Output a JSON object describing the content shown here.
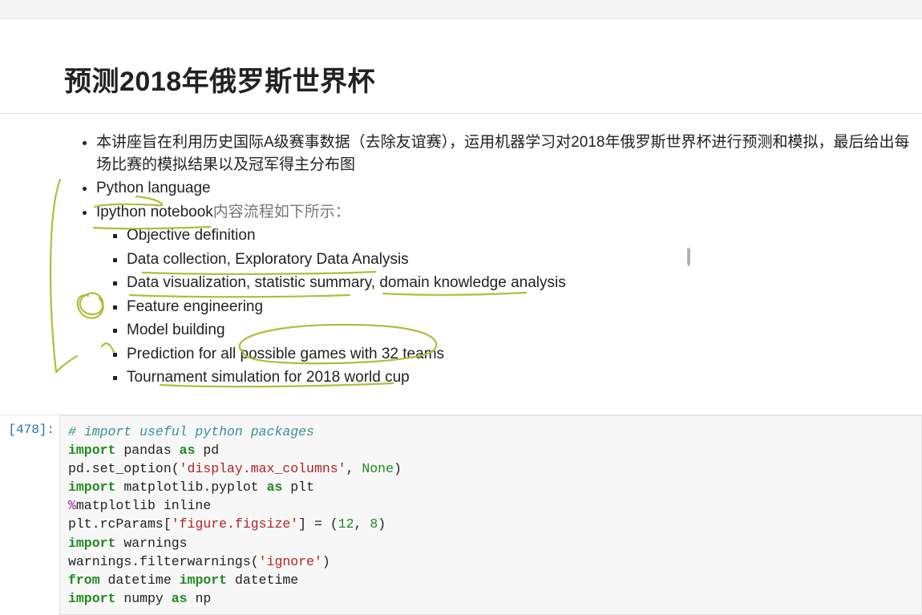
{
  "topbar": {},
  "markdown": {
    "title": "预测2018年俄罗斯世界杯",
    "b1": "本讲座旨在利用历史国际A级赛事数据（去除友谊赛），运用机器学习对2018年俄罗斯世界杯进行预测和模拟，最后给出每场比赛的模拟结果以及冠军得主分布图",
    "b2": "Python language",
    "b3_a": "Ipython notebook",
    "b3_b": "内容流程如下所示：",
    "sub": {
      "s1": "Objective definition",
      "s2": "Data collection, Exploratory Data Analysis",
      "s3": "Data visualization, statistic summary, domain knowledge analysis",
      "s4": "Feature engineering",
      "s5": "Model building",
      "s6": "Prediction for all possible games with 32 teams",
      "s7": "Tournament simulation for 2018 world cup"
    }
  },
  "code": {
    "prompt": "[478]:",
    "l1_comment": "# import useful python packages",
    "l2_k1": "import",
    "l2_t1": " pandas ",
    "l2_k2": "as",
    "l2_t2": " pd",
    "l3_t1": "pd.set_option(",
    "l3_s1": "'display.max_columns'",
    "l3_t2": ", ",
    "l3_none": "None",
    "l3_t3": ")",
    "l4_k1": "import",
    "l4_t1": " matplotlib.pyplot ",
    "l4_k2": "as",
    "l4_t2": " plt",
    "l5_m": "%",
    "l5_t": "matplotlib inline",
    "l6_t1": "plt.rcParams[",
    "l6_s1": "'figure.figsize'",
    "l6_t2": "] = (",
    "l6_n1": "12",
    "l6_t3": ", ",
    "l6_n2": "8",
    "l6_t4": ")",
    "l7_k1": "import",
    "l7_t1": " warnings",
    "l8_t1": "warnings.filterwarnings(",
    "l8_s1": "'ignore'",
    "l8_t2": ")",
    "l9_k1": "from",
    "l9_t1": " datetime ",
    "l9_k2": "import",
    "l9_t2": " datetime",
    "l10_k1": "import",
    "l10_t1": " numpy ",
    "l10_k2": "as",
    "l10_t2": " np"
  },
  "annotations": {
    "stroke_color": "#a7c23a"
  }
}
